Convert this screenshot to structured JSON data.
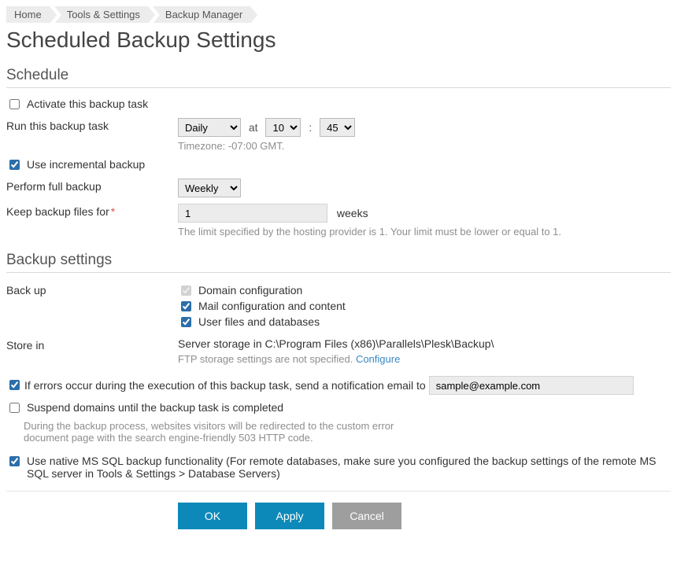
{
  "breadcrumb": [
    "Home",
    "Tools & Settings",
    "Backup Manager"
  ],
  "page_title": "Scheduled Backup Settings",
  "sections": {
    "schedule_title": "Schedule",
    "backup_settings_title": "Backup settings"
  },
  "schedule": {
    "activate_label": "Activate this backup task",
    "activate_checked": false,
    "run_label": "Run this backup task",
    "frequency": "Daily",
    "at": "at",
    "colon": ":",
    "hour": "10",
    "minute": "45",
    "timezone_note": "Timezone: -07:00 GMT.",
    "incremental_label": "Use incremental backup",
    "incremental_checked": true,
    "perform_full_label": "Perform full backup",
    "perform_full_value": "Weekly",
    "keep_label": "Keep backup files for",
    "keep_required": "*",
    "keep_value": "1",
    "keep_unit": "weeks",
    "keep_note": "The limit specified by the hosting provider is 1. Your limit must be lower or equal to 1."
  },
  "backup": {
    "backup_label": "Back up",
    "domain_cfg_label": "Domain configuration",
    "domain_cfg_checked": true,
    "mail_cfg_label": "Mail configuration and content",
    "mail_cfg_checked": true,
    "userfiles_label": "User files and databases",
    "userfiles_checked": true,
    "storein_label": "Store in",
    "storein_text": "Server storage in C:\\Program Files (x86)\\Parallels\\Plesk\\Backup\\",
    "ftp_note_prefix": "FTP storage settings are not specified. ",
    "ftp_configure": "Configure"
  },
  "options": {
    "notify_checked": true,
    "notify_label": "If errors occur during the execution of this backup task, send a notification email to",
    "notify_email": "sample@example.com",
    "suspend_checked": false,
    "suspend_label": "Suspend domains until the backup task is completed",
    "suspend_note": "During the backup process, websites visitors will be redirected to the custom error document page with the search engine-friendly 503 HTTP code.",
    "native_checked": true,
    "native_label": "Use native MS SQL backup functionality (For remote databases, make sure you configured the backup settings of the remote MS SQL server in Tools & Settings > Database Servers)"
  },
  "buttons": {
    "ok": "OK",
    "apply": "Apply",
    "cancel": "Cancel"
  }
}
